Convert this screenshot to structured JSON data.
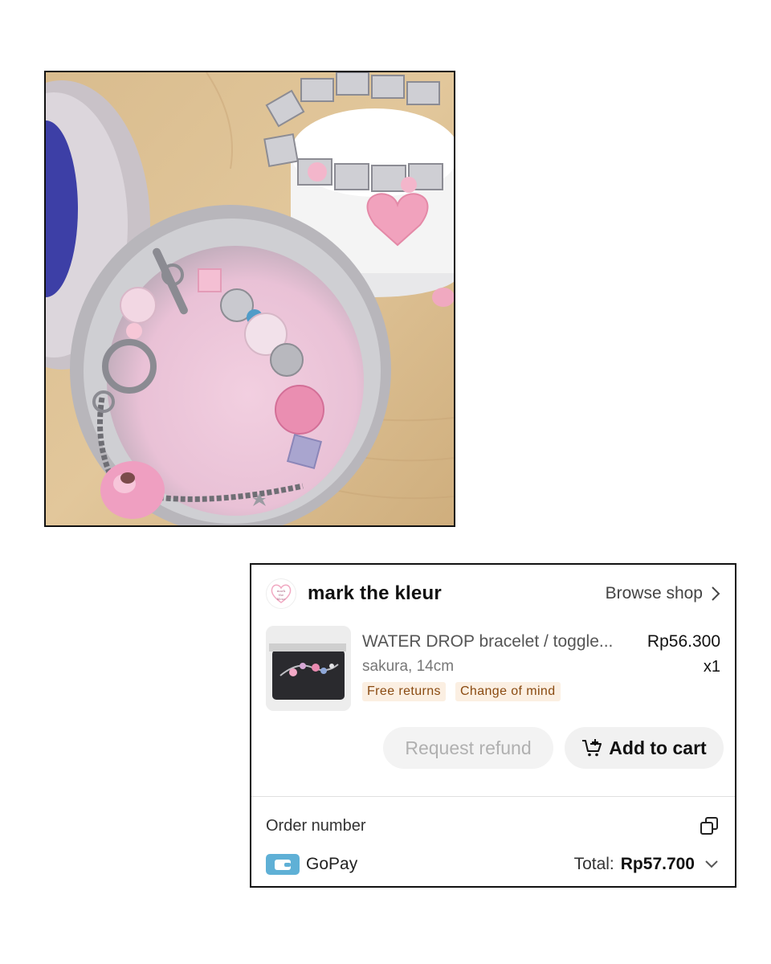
{
  "shop": {
    "name": "mark the kleur",
    "browse_label": "Browse shop"
  },
  "product": {
    "name": "WATER DROP bracelet / toggle...",
    "variant": "sakura, 14cm",
    "price": "Rp56.300",
    "quantity": "x1",
    "tags": [
      "Free returns",
      "Change of mind"
    ]
  },
  "actions": {
    "refund_label": "Request refund",
    "cart_label": "Add to cart"
  },
  "order": {
    "number_label": "Order number"
  },
  "payment": {
    "method": "GoPay",
    "total_label": "Total:",
    "total_value": "Rp57.700"
  },
  "icons": {
    "browse": "chevron-right-icon",
    "cart": "cart-plus-icon",
    "copy": "copy-icon",
    "wallet": "wallet-icon",
    "expand": "chevron-down-icon"
  },
  "colors": {
    "tag_bg": "#fbefe2",
    "tag_text": "#8a4b12",
    "wallet": "#5fb0d6",
    "button_bg": "#f1f1f1"
  }
}
